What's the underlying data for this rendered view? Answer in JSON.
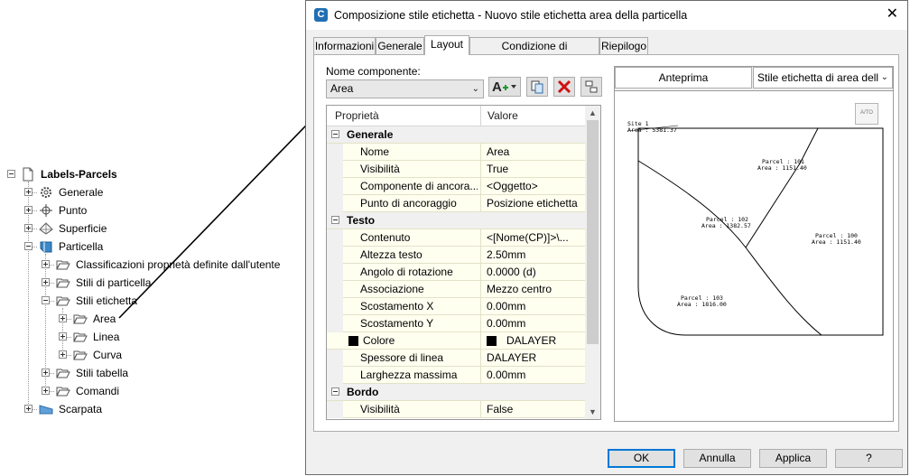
{
  "tree": {
    "root": "Labels-Parcels",
    "items": {
      "generale": "Generale",
      "punto": "Punto",
      "superficie": "Superficie",
      "particella": "Particella",
      "classificazioni": "Classificazioni proprietà definite dall'utente",
      "stili_particella": "Stili di particella",
      "stili_etichetta": "Stili etichetta",
      "area": "Area",
      "linea": "Linea",
      "curva": "Curva",
      "stili_tabella": "Stili tabella",
      "comandi": "Comandi",
      "scarpata": "Scarpata"
    }
  },
  "dialog": {
    "app_icon": "C",
    "title": "Composizione stile etichetta - Nuovo stile etichetta area della particella",
    "close": "✕",
    "tabs": [
      "Informazioni",
      "Generale",
      "Layout",
      "Condizione di trascinamento",
      "Riepilogo"
    ],
    "active_tab": "Layout",
    "component_label": "Nome componente:",
    "component_value": "Area",
    "grid": {
      "col_property": "Proprietà",
      "col_value": "Valore",
      "categories": {
        "generale": "Generale",
        "testo": "Testo",
        "bordo": "Bordo"
      },
      "generale_rows": [
        {
          "p": "Nome",
          "v": "Area"
        },
        {
          "p": "Visibilità",
          "v": "True"
        },
        {
          "p": "Componente di ancora...",
          "v": "<Oggetto>"
        },
        {
          "p": "Punto di ancoraggio",
          "v": "Posizione etichetta"
        }
      ],
      "testo_rows": [
        {
          "p": "Contenuto",
          "v": "<[Nome(CP)]>\\..."
        },
        {
          "p": "Altezza testo",
          "v": "2.50mm"
        },
        {
          "p": "Angolo di rotazione",
          "v": "0.0000 (d)"
        },
        {
          "p": "Associazione",
          "v": "Mezzo centro"
        },
        {
          "p": "Scostamento X",
          "v": "0.00mm"
        },
        {
          "p": "Scostamento Y",
          "v": "0.00mm"
        },
        {
          "p": "Colore",
          "v": "DALAYER"
        },
        {
          "p": "Spessore di linea",
          "v": "DALAYER"
        },
        {
          "p": "Larghezza massima",
          "v": "0.00mm"
        }
      ],
      "bordo_rows": [
        {
          "p": "Visibilità",
          "v": "False"
        }
      ]
    },
    "preview": {
      "label": "Anteprima",
      "style_value": "Stile etichetta di area della",
      "badge": "A/TO",
      "labels": {
        "site": "Site 1",
        "site_area": "Area : 5381.37",
        "p101": "Parcel : 101",
        "p101_area": "Area : 1151.40",
        "p102": "Parcel : 102",
        "p102_area": "Area : 1382.57",
        "p100": "Parcel : 100",
        "p100_area": "Area : 1151.40",
        "p103": "Parcel : 103",
        "p103_area": "Area : 1816.00"
      }
    },
    "buttons": {
      "ok": "OK",
      "annulla": "Annulla",
      "applica": "Applica",
      "help": "?"
    }
  }
}
